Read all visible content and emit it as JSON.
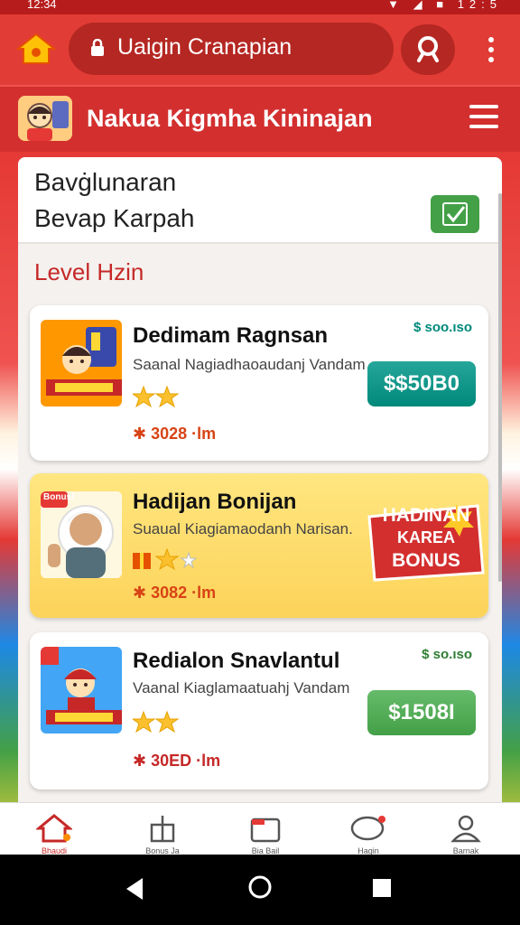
{
  "status_bar": {
    "time": "12:34",
    "icons": "▼ ◢ ■ 12:5"
  },
  "browser": {
    "url": "Uaigin Cranapian",
    "home_icon": "home-icon",
    "search_icon": "search-icon",
    "menu_icon": "more-vert-icon"
  },
  "site": {
    "title": "Nakua Kigmha Kininajan",
    "menu_icon": "hamburger-icon"
  },
  "panel": {
    "line1": "Bavġlunaran",
    "line2": "Bevap Karpah",
    "section_title": "Level Hzin"
  },
  "cards": [
    {
      "title": "Dedimam Ragnsan",
      "subtitle": "Saanal Nagiadhaoaudanj Vandam",
      "meta": "✱ 3028 ·lm",
      "small": "$ soo.ıso",
      "price": "$$50B0",
      "stars": 2,
      "price_color": "#00897b"
    },
    {
      "title": "Hadijan Bonijan",
      "subtitle": "Suaual Kiagiamaodanh Narisan.",
      "meta": "✱ 3082 ·lm",
      "badge_line1": "HADINAN",
      "badge_line2": "KAREA",
      "badge_line3": "BONUS",
      "thumb_label": "Bonus!",
      "stars": 2
    },
    {
      "title": "Redialon Snavlantul",
      "subtitle": "Vaanal Kiaglamaatuahj Vandam",
      "meta": "✱ 30ED ·lm",
      "small": "$ so.ıso",
      "price": "$1508I",
      "stars": 2,
      "price_color": "#43a047"
    }
  ],
  "bottom_nav": [
    {
      "label": "Bhaudi",
      "icon": "home-icon"
    },
    {
      "label": "Bonus Ja",
      "icon": "gift-icon"
    },
    {
      "label": "Bia Bail",
      "icon": "folder-icon"
    },
    {
      "label": "Hagin",
      "icon": "chat-icon"
    },
    {
      "label": "Barnak",
      "icon": "person-icon"
    }
  ],
  "colors": {
    "brand_red": "#d32f2f",
    "accent_gold": "#fcd35a",
    "teal": "#00897b",
    "green": "#43a047"
  }
}
